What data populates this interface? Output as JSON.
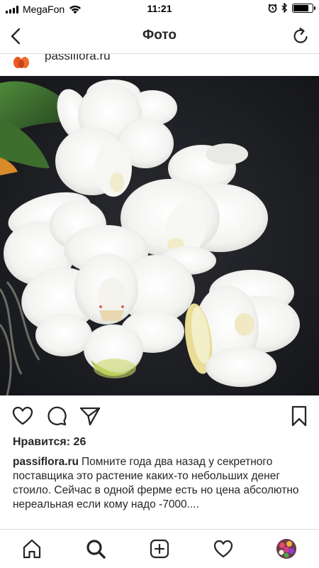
{
  "status_bar": {
    "carrier": "MegaFon",
    "time": "11:21",
    "battery_level": 0.82
  },
  "nav": {
    "title": "Фото"
  },
  "post": {
    "username": "passiflora.ru",
    "likes_label": "Нравится:",
    "likes_count": "26",
    "caption_text": "Помните года два назад  у секретного поставщика это растение  каких-то небольших денег стоило. Сейчас в одной ферме есть но цена абсолютно нереальная если кому надо -7000...."
  },
  "icons": {
    "back": "chevron-left-icon",
    "refresh": "refresh-icon",
    "like": "heart-icon",
    "comment": "comment-icon",
    "share": "paper-plane-icon",
    "save": "bookmark-icon",
    "home": "home-icon",
    "search": "search-icon",
    "add": "add-post-icon",
    "activity": "heart-icon",
    "profile": "avatar"
  },
  "colors": {
    "text": "#262626",
    "divider": "#dbdbdb",
    "photo_background": "#1e2024"
  }
}
